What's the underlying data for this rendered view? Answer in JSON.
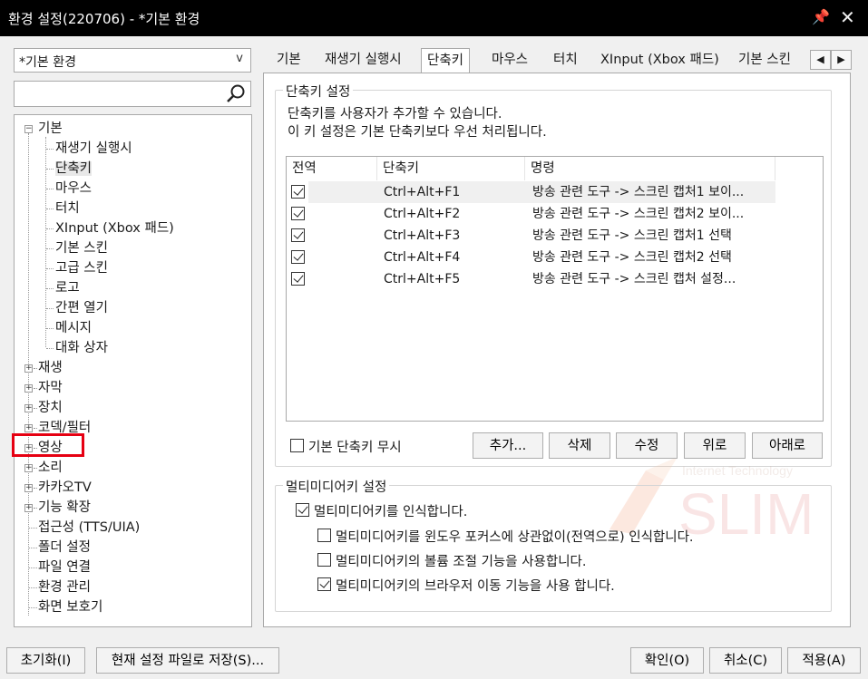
{
  "window": {
    "title": "환경 설정(220706) - *기본 환경",
    "pin_glyph": "📌",
    "close_glyph": "✕"
  },
  "preset_combo": {
    "value": "*기본 환경",
    "arrow": "v"
  },
  "search": {
    "value": "",
    "placeholder": ""
  },
  "tree": {
    "root_label": "기본",
    "children": [
      "재생기 실행시",
      "단축키",
      "마우스",
      "터치",
      "XInput (Xbox 패드)",
      "기본 스킨",
      "고급 스킨",
      "로고",
      "간편 열기",
      "메시지",
      "대화 상자"
    ],
    "collapsed": [
      "재생",
      "자막",
      "장치",
      "코덱/필터",
      "영상",
      "소리",
      "카카오TV",
      "기능 확장"
    ],
    "leaves": [
      "접근성 (TTS/UIA)",
      "폴더 설정",
      "파일 연결",
      "환경 관리",
      "화면 보호기"
    ]
  },
  "tabs": [
    "기본",
    "재생기 실행시",
    "단축키",
    "마우스",
    "터치",
    "XInput (Xbox 패드)",
    "기본 스킨"
  ],
  "tab_scroll": {
    "left": "◀",
    "right": "▶"
  },
  "shortcut_group": {
    "title": "단축키 설정",
    "desc_line1": "단축키를 사용자가 추가할 수 있습니다.",
    "desc_line2": "이 키 설정은 기본 단축키보다 우선 처리됩니다.",
    "columns": [
      "전역",
      "단축키",
      "명령"
    ],
    "rows": [
      {
        "global": true,
        "key": "Ctrl+Alt+F1",
        "command": "방송 관련 도구 -> 스크린 캡처1 보이..."
      },
      {
        "global": true,
        "key": "Ctrl+Alt+F2",
        "command": "방송 관련 도구 -> 스크린 캡처2 보이..."
      },
      {
        "global": true,
        "key": "Ctrl+Alt+F3",
        "command": "방송 관련 도구 -> 스크린 캡처1 선택"
      },
      {
        "global": true,
        "key": "Ctrl+Alt+F4",
        "command": "방송 관련 도구 -> 스크린 캡처2 선택"
      },
      {
        "global": true,
        "key": "Ctrl+Alt+F5",
        "command": "방송 관련 도구 -> 스크린 캡처 설정..."
      }
    ],
    "ignore_default_label": "기본 단축키 무시",
    "ignore_default_checked": false,
    "buttons": {
      "add": "추가...",
      "delete": "삭제",
      "edit": "수정",
      "up": "위로",
      "down": "아래로"
    }
  },
  "multimedia_group": {
    "title": "멀티미디어키 설정",
    "options": [
      {
        "label": "멀티미디어키를 인식합니다.",
        "checked": true
      },
      {
        "label": "멀티미디어키를 윈도우 포커스에 상관없이(전역으로) 인식합니다.",
        "checked": false
      },
      {
        "label": "멀티미디어키의 볼륨 조절 기능을 사용합니다.",
        "checked": false
      },
      {
        "label": "멀티미디어키의 브라우저 이동 기능을 사용 합니다.",
        "checked": true
      }
    ]
  },
  "bottom_buttons": {
    "reset": "초기화(I)",
    "save_file": "현재 설정 파일로 저장(S)...",
    "ok": "확인(O)",
    "cancel": "취소(C)",
    "apply": "적용(A)"
  },
  "watermark": {
    "line1": "Internet Technology",
    "line2": "SLIM"
  },
  "colors": {
    "titlebar": "#000000",
    "highlight": "#e60012",
    "window_bg": "#f0f0f0"
  }
}
